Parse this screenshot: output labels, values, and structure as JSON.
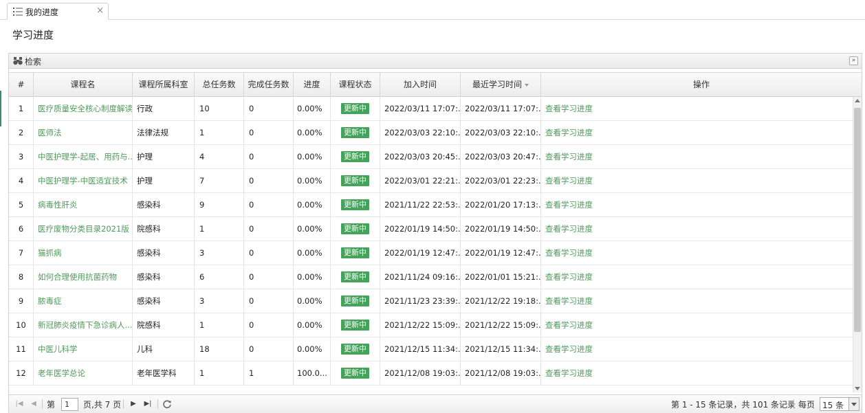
{
  "tab": {
    "title": "我的进度"
  },
  "page": {
    "title": "学习进度"
  },
  "search_panel": {
    "label": "检索"
  },
  "columns": [
    "#",
    "课程名",
    "课程所属科室",
    "总任务数",
    "完成任务数",
    "进度",
    "课程状态",
    "加入时间",
    "最近学习时间",
    "操作"
  ],
  "rows": [
    {
      "no": "1",
      "name": "医疗质量安全核心制度解读",
      "dept": "行政",
      "total": "10",
      "done": "0",
      "progress": "0.00%",
      "status": "更新中",
      "joined": "2022/03/11 17:07:...",
      "last": "2022/03/11 17:07:...",
      "action": "查看学习进度"
    },
    {
      "no": "2",
      "name": "医师法",
      "dept": "法律法规",
      "total": "1",
      "done": "0",
      "progress": "0.00%",
      "status": "更新中",
      "joined": "2022/03/03 22:10:...",
      "last": "2022/03/03 22:10:...",
      "action": "查看学习进度"
    },
    {
      "no": "3",
      "name": "中医护理学-起居、用药与...",
      "dept": "护理",
      "total": "4",
      "done": "0",
      "progress": "0.00%",
      "status": "更新中",
      "joined": "2022/03/03 20:45:...",
      "last": "2022/03/03 20:47:...",
      "action": "查看学习进度"
    },
    {
      "no": "4",
      "name": "中医护理学-中医适宜技术",
      "dept": "护理",
      "total": "7",
      "done": "0",
      "progress": "0.00%",
      "status": "更新中",
      "joined": "2022/03/01 22:21:...",
      "last": "2022/03/01 22:23:...",
      "action": "查看学习进度"
    },
    {
      "no": "5",
      "name": "病毒性肝炎",
      "dept": "感染科",
      "total": "9",
      "done": "0",
      "progress": "0.00%",
      "status": "更新中",
      "joined": "2021/11/22 22:53:...",
      "last": "2022/01/20 17:13:...",
      "action": "查看学习进度"
    },
    {
      "no": "6",
      "name": "医疗废物分类目录2021版",
      "dept": "院感科",
      "total": "1",
      "done": "0",
      "progress": "0.00%",
      "status": "更新中",
      "joined": "2022/01/19 14:50:...",
      "last": "2022/01/19 14:50:...",
      "action": "查看学习进度"
    },
    {
      "no": "7",
      "name": "猫抓病",
      "dept": "感染科",
      "total": "3",
      "done": "0",
      "progress": "0.00%",
      "status": "更新中",
      "joined": "2022/01/19 12:47:...",
      "last": "2022/01/19 12:47:...",
      "action": "查看学习进度"
    },
    {
      "no": "8",
      "name": "如何合理使用抗菌药物",
      "dept": "感染科",
      "total": "6",
      "done": "0",
      "progress": "0.00%",
      "status": "更新中",
      "joined": "2021/11/24 09:16:...",
      "last": "2022/01/01 15:21:...",
      "action": "查看学习进度"
    },
    {
      "no": "9",
      "name": "脓毒症",
      "dept": "感染科",
      "total": "3",
      "done": "0",
      "progress": "0.00%",
      "status": "更新中",
      "joined": "2021/11/23 23:39:...",
      "last": "2021/12/22 19:18:...",
      "action": "查看学习进度"
    },
    {
      "no": "10",
      "name": "新冠肺炎疫情下急诊病人...",
      "dept": "院感科",
      "total": "1",
      "done": "0",
      "progress": "0.00%",
      "status": "更新中",
      "joined": "2021/12/22 15:09:...",
      "last": "2021/12/22 15:09:...",
      "action": "查看学习进度"
    },
    {
      "no": "11",
      "name": "中医儿科学",
      "dept": "儿科",
      "total": "18",
      "done": "0",
      "progress": "0.00%",
      "status": "更新中",
      "joined": "2021/12/15 11:34:...",
      "last": "2021/12/15 11:34:...",
      "action": "查看学习进度"
    },
    {
      "no": "12",
      "name": "老年医学总论",
      "dept": "老年医学科",
      "total": "1",
      "done": "1",
      "progress": "100.0...",
      "status": "更新中",
      "joined": "2021/12/08 19:03:...",
      "last": "2021/12/08 19:03:...",
      "action": "查看学习进度"
    }
  ],
  "pager": {
    "page_prefix": "第",
    "current_page": "1",
    "page_suffix": "页,共 7 页",
    "records_text": "第 1 - 15 条记录，共 101 条记录",
    "per_page_label": "每页",
    "per_page_value": "15 条"
  },
  "colors": {
    "link": "#4e9a5a",
    "badge": "#45a25a"
  }
}
